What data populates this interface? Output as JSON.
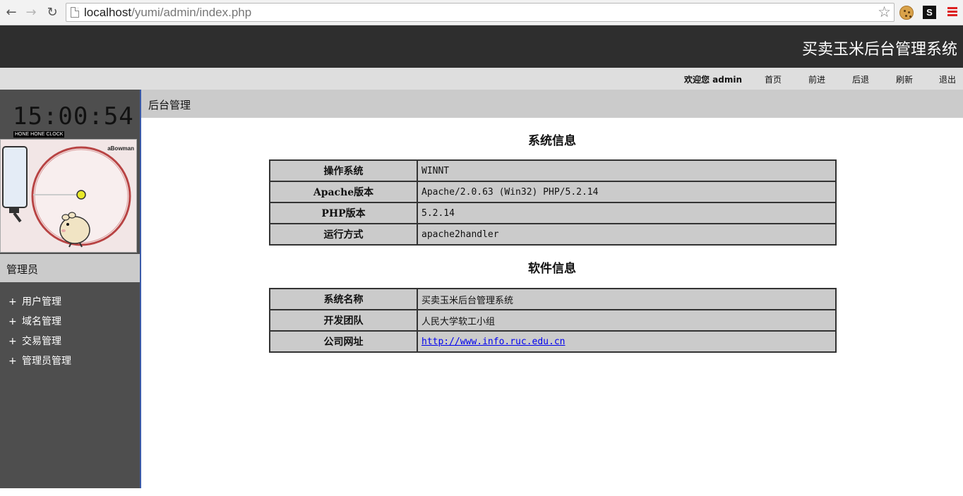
{
  "browser": {
    "url_host": "localhost",
    "url_path": "/yumi/admin/index.php",
    "back_icon": "←",
    "forward_icon": "→",
    "reload_icon": "↻",
    "star_icon": "☆",
    "extension_s": "S"
  },
  "app": {
    "title": "买卖玉米后台管理系统"
  },
  "topnav": {
    "welcome": "欢迎您 admin",
    "links": [
      "首页",
      "前进",
      "后退",
      "刷新",
      "退出"
    ]
  },
  "sidebar": {
    "clock_time": "15:00:54",
    "clock_label": "HONE HONE CLOCK",
    "hamster_brand": "aBowman",
    "admin_label": "管理员",
    "plus": "+",
    "items": [
      "用户管理",
      "域名管理",
      "交易管理",
      "管理员管理"
    ]
  },
  "content": {
    "title": "后台管理",
    "system_section": {
      "heading": "系统信息",
      "rows": [
        {
          "key": "操作系统",
          "value": "WINNT"
        },
        {
          "key": "Apache版本",
          "value": "Apache/2.0.63 (Win32) PHP/5.2.14"
        },
        {
          "key": "PHP版本",
          "value": "5.2.14"
        },
        {
          "key": "运行方式",
          "value": "apache2handler"
        }
      ]
    },
    "software_section": {
      "heading": "软件信息",
      "rows": [
        {
          "key": "系统名称",
          "value": "买卖玉米后台管理系统"
        },
        {
          "key": "开发团队",
          "value": "人民大学软工小组"
        },
        {
          "key": "公司网址",
          "value": "http://www.info.ruc.edu.cn"
        }
      ]
    }
  }
}
